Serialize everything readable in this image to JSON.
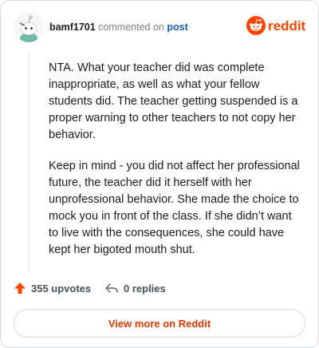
{
  "header": {
    "username": "bamf1701",
    "action_text": "commented on",
    "post_link": "post",
    "brand_wordmark": "reddit"
  },
  "comment": {
    "paragraphs": [
      "NTA. What your teacher did was complete inappropriate, as well as what your fellow students did. The teacher getting suspended is a proper warning to other teachers to not copy her behavior.",
      "Keep in mind - you did not affect her professional future, the teacher did it herself with her unprofessional behavior. She made the choice to mock you in front of the class. If she didn’t want to live with the consequences, she could have kept her bigoted mouth shut."
    ]
  },
  "footer": {
    "upvotes_label": "355 upvotes",
    "replies_label": "0 replies",
    "upvote_icon": "upvote-arrow-icon",
    "reply_icon": "reply-arrow-icon"
  },
  "cta": {
    "label": "View more on Reddit"
  },
  "colors": {
    "brand": "#ff4500",
    "cta_text": "#d93a00",
    "link": "#1a5fa8",
    "upvote": "#ff4500"
  }
}
